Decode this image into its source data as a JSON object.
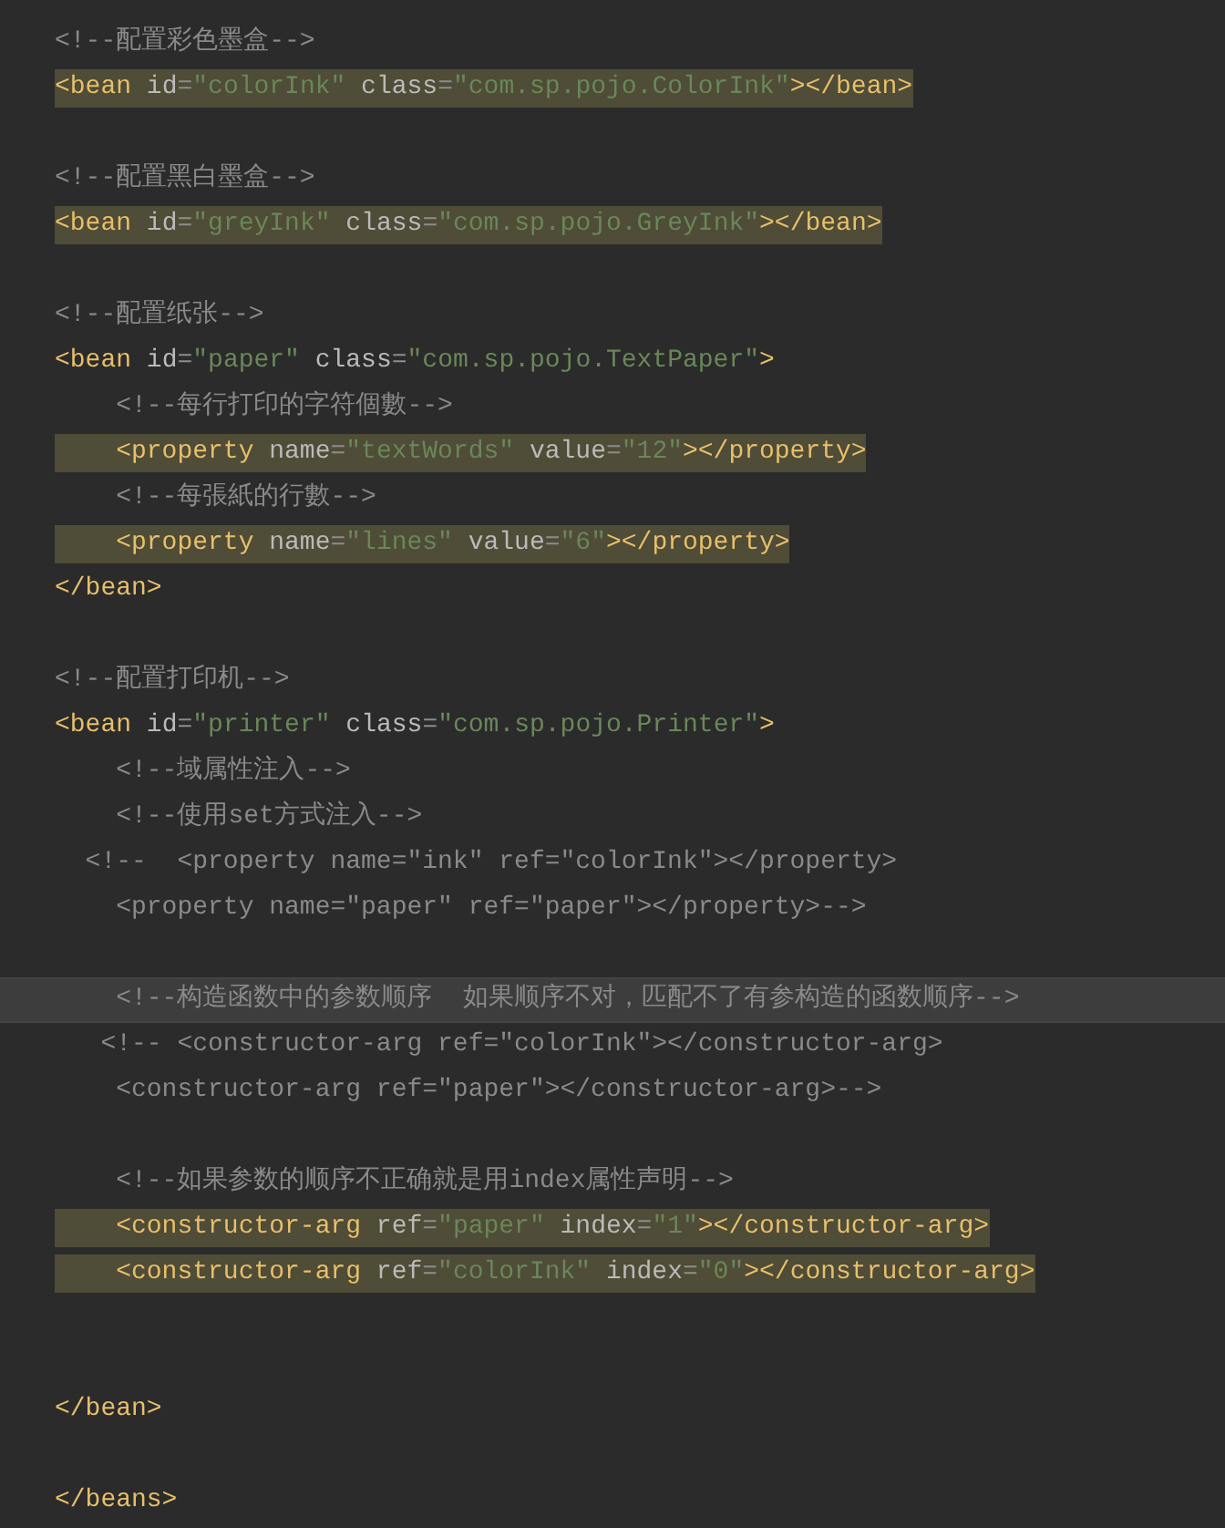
{
  "editor": {
    "lines": [
      {
        "current": false,
        "highlighted": false,
        "tokens": [
          {
            "kind": "comment",
            "text": "<!--配置彩色墨盒-->"
          }
        ]
      },
      {
        "current": false,
        "highlighted": true,
        "tokens": [
          {
            "kind": "tag",
            "text": "<bean"
          },
          {
            "kind": "attr",
            "text": " id"
          },
          {
            "kind": "eq",
            "text": "="
          },
          {
            "kind": "value",
            "text": "\"colorInk\""
          },
          {
            "kind": "attr",
            "text": " class"
          },
          {
            "kind": "eq",
            "text": "="
          },
          {
            "kind": "value",
            "text": "\"com.sp.pojo.ColorInk\""
          },
          {
            "kind": "tag",
            "text": "></bean>"
          }
        ]
      },
      {
        "current": false,
        "highlighted": false
      },
      {
        "current": false,
        "highlighted": false,
        "tokens": [
          {
            "kind": "comment",
            "text": "<!--配置黑白墨盒-->"
          }
        ]
      },
      {
        "current": false,
        "highlighted": true,
        "tokens": [
          {
            "kind": "tag",
            "text": "<bean"
          },
          {
            "kind": "attr",
            "text": " id"
          },
          {
            "kind": "eq",
            "text": "="
          },
          {
            "kind": "value",
            "text": "\"greyInk\""
          },
          {
            "kind": "attr",
            "text": " class"
          },
          {
            "kind": "eq",
            "text": "="
          },
          {
            "kind": "value",
            "text": "\"com.sp.pojo.GreyInk\""
          },
          {
            "kind": "tag",
            "text": "></bean>"
          }
        ]
      },
      {
        "current": false,
        "highlighted": false
      },
      {
        "current": false,
        "highlighted": false,
        "tokens": [
          {
            "kind": "comment",
            "text": "<!--配置纸张-->"
          }
        ]
      },
      {
        "current": false,
        "highlighted": false,
        "tokens": [
          {
            "kind": "tag",
            "text": "<bean"
          },
          {
            "kind": "attr",
            "text": " id"
          },
          {
            "kind": "eq",
            "text": "="
          },
          {
            "kind": "value",
            "text": "\"paper\""
          },
          {
            "kind": "attr",
            "text": " class"
          },
          {
            "kind": "eq",
            "text": "="
          },
          {
            "kind": "value",
            "text": "\"com.sp.pojo.TextPaper\""
          },
          {
            "kind": "tag",
            "text": ">"
          }
        ]
      },
      {
        "current": false,
        "highlighted": false,
        "tokens": [
          {
            "kind": "comment",
            "text": "    <!--每行打印的字符個數-->"
          }
        ]
      },
      {
        "current": false,
        "highlighted": true,
        "tokens": [
          {
            "kind": "tag",
            "text": "    <property"
          },
          {
            "kind": "attr",
            "text": " name"
          },
          {
            "kind": "eq",
            "text": "="
          },
          {
            "kind": "value",
            "text": "\"textWords\""
          },
          {
            "kind": "attr",
            "text": " value"
          },
          {
            "kind": "eq",
            "text": "="
          },
          {
            "kind": "value",
            "text": "\"12\""
          },
          {
            "kind": "tag",
            "text": "></property>"
          }
        ]
      },
      {
        "current": false,
        "highlighted": false,
        "tokens": [
          {
            "kind": "comment",
            "text": "    <!--每張紙的行數-->"
          }
        ]
      },
      {
        "current": false,
        "highlighted": true,
        "tokens": [
          {
            "kind": "tag",
            "text": "    <property"
          },
          {
            "kind": "attr",
            "text": " name"
          },
          {
            "kind": "eq",
            "text": "="
          },
          {
            "kind": "value",
            "text": "\"lines\""
          },
          {
            "kind": "attr",
            "text": " value"
          },
          {
            "kind": "eq",
            "text": "="
          },
          {
            "kind": "value",
            "text": "\"6\""
          },
          {
            "kind": "tag",
            "text": "></property>"
          }
        ]
      },
      {
        "current": false,
        "highlighted": false,
        "tokens": [
          {
            "kind": "tag",
            "text": "</bean>"
          }
        ]
      },
      {
        "current": false,
        "highlighted": false
      },
      {
        "current": false,
        "highlighted": false,
        "tokens": [
          {
            "kind": "comment",
            "text": "<!--配置打印机-->"
          }
        ]
      },
      {
        "current": false,
        "highlighted": false,
        "tokens": [
          {
            "kind": "tag",
            "text": "<bean"
          },
          {
            "kind": "attr",
            "text": " id"
          },
          {
            "kind": "eq",
            "text": "="
          },
          {
            "kind": "value",
            "text": "\"printer\""
          },
          {
            "kind": "attr",
            "text": " class"
          },
          {
            "kind": "eq",
            "text": "="
          },
          {
            "kind": "value",
            "text": "\"com.sp.pojo.Printer\""
          },
          {
            "kind": "tag",
            "text": ">"
          }
        ]
      },
      {
        "current": false,
        "highlighted": false,
        "tokens": [
          {
            "kind": "comment",
            "text": "    <!--域属性注入-->"
          }
        ]
      },
      {
        "current": false,
        "highlighted": false,
        "tokens": [
          {
            "kind": "comment",
            "text": "    <!--使用set方式注入-->"
          }
        ]
      },
      {
        "current": false,
        "highlighted": false,
        "tokens": [
          {
            "kind": "comment",
            "text": "  <!--  <property name=\"ink\" ref=\"colorInk\"></property>"
          }
        ]
      },
      {
        "current": false,
        "highlighted": false,
        "tokens": [
          {
            "kind": "comment",
            "text": "    <property name=\"paper\" ref=\"paper\"></property>-->"
          }
        ]
      },
      {
        "current": false,
        "highlighted": false
      },
      {
        "current": true,
        "highlighted": false,
        "tokens": [
          {
            "kind": "comment",
            "text": "    <!--构造函数中的参数顺序  如果顺序不对，匹配不了有参构造的函数顺序-->"
          }
        ]
      },
      {
        "current": false,
        "highlighted": false,
        "tokens": [
          {
            "kind": "comment",
            "text": "   <!-- <constructor-arg ref=\"colorInk\"></constructor-arg>"
          }
        ]
      },
      {
        "current": false,
        "highlighted": false,
        "tokens": [
          {
            "kind": "comment",
            "text": "    <constructor-arg ref=\"paper\"></constructor-arg>-->"
          }
        ]
      },
      {
        "current": false,
        "highlighted": false
      },
      {
        "current": false,
        "highlighted": false,
        "tokens": [
          {
            "kind": "comment",
            "text": "    <!--如果参数的顺序不正确就是用index属性声明-->"
          }
        ]
      },
      {
        "current": false,
        "highlighted": true,
        "tokens": [
          {
            "kind": "tag",
            "text": "    <constructor-arg"
          },
          {
            "kind": "attr",
            "text": " ref"
          },
          {
            "kind": "eq",
            "text": "="
          },
          {
            "kind": "value",
            "text": "\"paper\""
          },
          {
            "kind": "attr",
            "text": " index"
          },
          {
            "kind": "eq",
            "text": "="
          },
          {
            "kind": "value",
            "text": "\"1\""
          },
          {
            "kind": "tag",
            "text": "></constructor-arg>"
          }
        ]
      },
      {
        "current": false,
        "highlighted": true,
        "tokens": [
          {
            "kind": "tag",
            "text": "    <constructor-arg"
          },
          {
            "kind": "attr",
            "text": " ref"
          },
          {
            "kind": "eq",
            "text": "="
          },
          {
            "kind": "value",
            "text": "\"colorInk\""
          },
          {
            "kind": "attr",
            "text": " index"
          },
          {
            "kind": "eq",
            "text": "="
          },
          {
            "kind": "value",
            "text": "\"0\""
          },
          {
            "kind": "tag",
            "text": "></constructor-arg>"
          }
        ]
      },
      {
        "current": false,
        "highlighted": false
      },
      {
        "current": false,
        "highlighted": false
      },
      {
        "current": false,
        "highlighted": false,
        "tokens": [
          {
            "kind": "tag",
            "text": "</bean>"
          }
        ]
      },
      {
        "current": false,
        "highlighted": false
      },
      {
        "current": false,
        "highlighted": false,
        "tokens": [
          {
            "kind": "tag",
            "text": "</beans>"
          }
        ]
      }
    ]
  }
}
